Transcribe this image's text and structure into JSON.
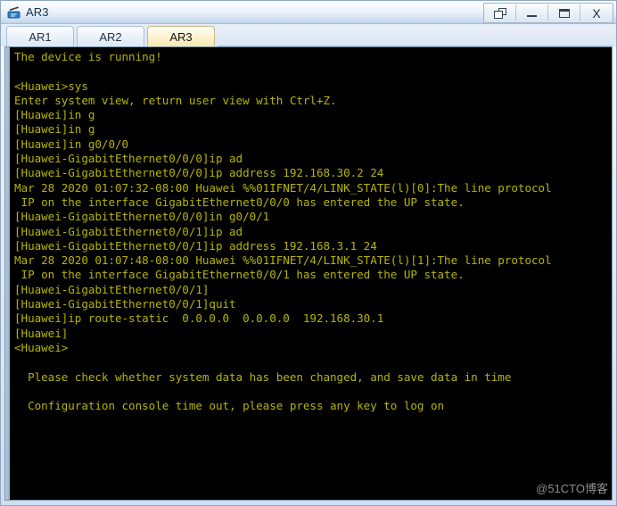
{
  "window": {
    "title": "AR3",
    "icon": "router-icon",
    "controls": [
      {
        "name": "cascade-windows-button",
        "glyph": "cascade-icon",
        "label": "Cascade"
      },
      {
        "name": "minimize-button",
        "glyph": "minimize-icon",
        "label": "Minimize"
      },
      {
        "name": "maximize-button",
        "glyph": "maximize-icon",
        "label": "Maximize"
      },
      {
        "name": "close-button",
        "glyph": "close-icon",
        "label": "X"
      }
    ]
  },
  "tabs": [
    {
      "label": "AR1",
      "active": false
    },
    {
      "label": "AR2",
      "active": false
    },
    {
      "label": "AR3",
      "active": true
    }
  ],
  "terminal": {
    "foreground": "#b5b500",
    "background": "#000000",
    "lines": [
      "The device is running!",
      "",
      "<Huawei>sys",
      "Enter system view, return user view with Ctrl+Z.",
      "[Huawei]in g",
      "[Huawei]in g",
      "[Huawei]in g0/0/0",
      "[Huawei-GigabitEthernet0/0/0]ip ad",
      "[Huawei-GigabitEthernet0/0/0]ip address 192.168.30.2 24",
      "Mar 28 2020 01:07:32-08:00 Huawei %%01IFNET/4/LINK_STATE(l)[0]:The line protocol",
      " IP on the interface GigabitEthernet0/0/0 has entered the UP state.",
      "[Huawei-GigabitEthernet0/0/0]in g0/0/1",
      "[Huawei-GigabitEthernet0/0/1]ip ad",
      "[Huawei-GigabitEthernet0/0/1]ip address 192.168.3.1 24",
      "Mar 28 2020 01:07:48-08:00 Huawei %%01IFNET/4/LINK_STATE(l)[1]:The line protocol",
      " IP on the interface GigabitEthernet0/0/1 has entered the UP state.",
      "[Huawei-GigabitEthernet0/0/1]",
      "[Huawei-GigabitEthernet0/0/1]quit",
      "[Huawei]ip route-static  0.0.0.0  0.0.0.0  192.168.30.1",
      "[Huawei]",
      "<Huawei>",
      "",
      "  Please check whether system data has been changed, and save data in time",
      "",
      "  Configuration console time out, please press any key to log on"
    ]
  },
  "watermark": {
    "text": "@51CTO博客"
  }
}
